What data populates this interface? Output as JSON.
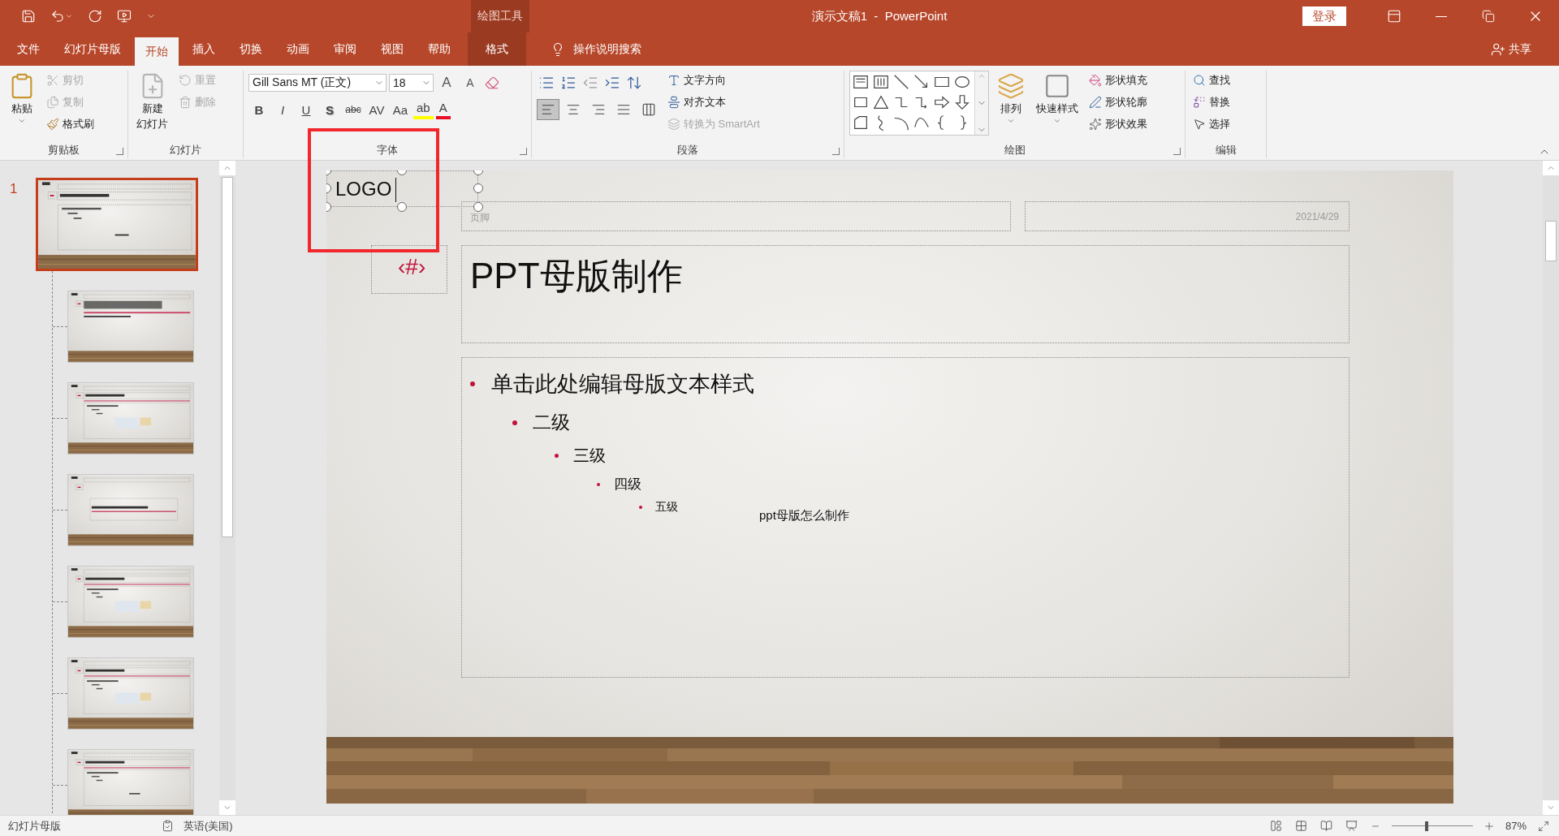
{
  "window": {
    "context_group": "绘图工具",
    "title": "演示文稿1  -  PowerPoint",
    "sign_in": "登录"
  },
  "tabs": [
    {
      "label": "文件",
      "selected": false,
      "kind": "normal"
    },
    {
      "label": "幻灯片母版",
      "selected": false,
      "kind": "normal"
    },
    {
      "label": "开始",
      "selected": true,
      "kind": "normal"
    },
    {
      "label": "插入",
      "selected": false,
      "kind": "normal"
    },
    {
      "label": "切换",
      "selected": false,
      "kind": "normal"
    },
    {
      "label": "动画",
      "selected": false,
      "kind": "normal"
    },
    {
      "label": "审阅",
      "selected": false,
      "kind": "normal"
    },
    {
      "label": "视图",
      "selected": false,
      "kind": "normal"
    },
    {
      "label": "帮助",
      "selected": false,
      "kind": "normal"
    },
    {
      "label": "格式",
      "selected": false,
      "kind": "contextual"
    }
  ],
  "tell_me": "操作说明搜索",
  "share": "共享",
  "clipboard": {
    "label": "剪贴板",
    "paste": "粘贴",
    "items": [
      {
        "label": "剪切",
        "kind": "cut",
        "disabled": true
      },
      {
        "label": "复制",
        "kind": "copy",
        "disabled": true
      },
      {
        "label": "格式刷",
        "kind": "painter",
        "disabled": false
      }
    ]
  },
  "slides_group": {
    "label": "幻灯片",
    "new_slide": [
      "新建",
      "幻灯片"
    ],
    "items": [
      {
        "label": "重置",
        "kind": "reset",
        "disabled": true
      },
      {
        "label": "删除",
        "kind": "delete",
        "disabled": true
      }
    ]
  },
  "font": {
    "label": "字体",
    "family": "Gill Sans MT (正文)",
    "size": "18",
    "size_buttons": [
      {
        "label": "A",
        "kind": "grow"
      },
      {
        "label": "A",
        "kind": "shrink"
      }
    ],
    "buttons": [
      {
        "label": "B",
        "kind": "bold"
      },
      {
        "label": "I",
        "kind": "italic"
      },
      {
        "label": "U",
        "kind": "underline"
      },
      {
        "label": "S",
        "kind": "shadow"
      },
      {
        "label": "abc",
        "kind": "strike"
      },
      {
        "label": "AV",
        "kind": "spacing"
      },
      {
        "label": "Aa",
        "kind": "case"
      }
    ],
    "color_buttons": [
      {
        "label": "ab",
        "kind": "highlight"
      },
      {
        "label": "A",
        "kind": "color"
      }
    ]
  },
  "paragraph": {
    "label": "段落",
    "align": [
      {
        "kind": "left",
        "selected": true
      },
      {
        "kind": "center",
        "selected": false
      },
      {
        "kind": "right",
        "selected": false
      },
      {
        "kind": "justify",
        "selected": false
      },
      {
        "kind": "distributed",
        "selected": false
      }
    ],
    "items": [
      {
        "label": "文字方向",
        "kind": "direction",
        "disabled": false
      },
      {
        "label": "对齐文本",
        "kind": "align",
        "disabled": false
      },
      {
        "label": "转换为 SmartArt",
        "kind": "smartart",
        "disabled": true
      }
    ]
  },
  "drawing": {
    "label": "绘图",
    "arrange": "排列",
    "quick_styles": "快速样式",
    "items": [
      {
        "label": "形状填充",
        "kind": "fill"
      },
      {
        "label": "形状轮廓",
        "kind": "outline"
      },
      {
        "label": "形状效果",
        "kind": "effects"
      }
    ]
  },
  "editing": {
    "label": "编辑",
    "items": [
      {
        "label": "查找",
        "kind": "find"
      },
      {
        "label": "替换",
        "kind": "replace"
      },
      {
        "label": "选择",
        "kind": "select"
      }
    ]
  },
  "master": {
    "number": "1",
    "selected": true,
    "layouts": [
      {
        "selected": false
      },
      {
        "selected": false
      },
      {
        "selected": false
      },
      {
        "selected": false
      },
      {
        "selected": false
      },
      {
        "selected": false
      }
    ]
  },
  "slide": {
    "logo": "LOGO",
    "footer": "页脚",
    "date": "2021/4/29",
    "number": "‹#›",
    "title": "PPT母版制作",
    "body": [
      {
        "text": "单击此处编辑母版文本样式",
        "children": [
          {
            "text": "二级",
            "children": [
              {
                "text": "三级",
                "children": [
                  {
                    "text": "四级",
                    "children": [
                      {
                        "text": "五级"
                      }
                    ]
                  }
                ]
              }
            ]
          }
        ]
      }
    ],
    "note": "ppt母版怎么制作"
  },
  "status_bar": {
    "view": "幻灯片母版",
    "language": "英语(美国)",
    "zoom": {
      "level": 0.43,
      "reading": "87%"
    }
  }
}
